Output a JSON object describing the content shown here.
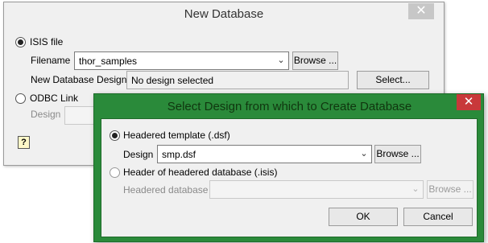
{
  "back": {
    "title": "New Database",
    "close": "✕",
    "isis_label": "ISIS file",
    "filename_label": "Filename",
    "filename_value": "thor_samples",
    "browse1": "Browse ...",
    "design_label": "New Database Design",
    "design_value": "No design selected",
    "select_btn": "Select...",
    "odbc_label": "ODBC Link",
    "design_label_disabled": "Design",
    "help": "?"
  },
  "front": {
    "title": "Select Design from which to Create Database",
    "close": "✕",
    "radio_template_label": "Headered template (.dsf)",
    "design_label": "Design",
    "design_value": "smp.dsf",
    "browse1": "Browse ...",
    "radio_header_label": "Header of headered database (.isis)",
    "headered_db_label": "Headered database",
    "headered_db_value": "",
    "browse2": "Browse ...",
    "ok": "OK",
    "cancel": "Cancel"
  }
}
